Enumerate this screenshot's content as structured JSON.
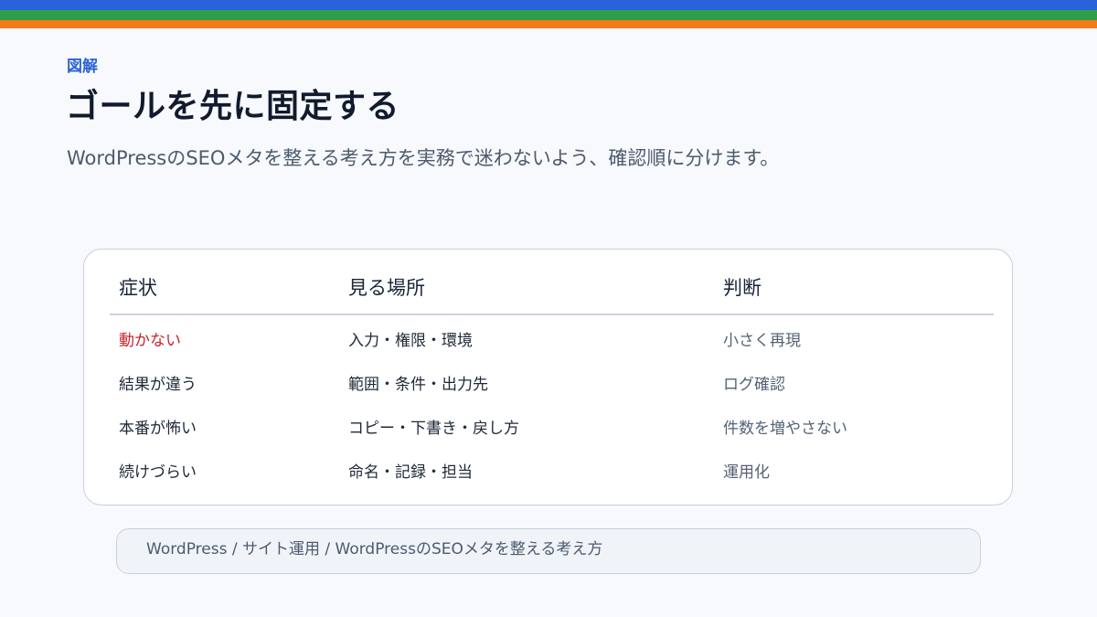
{
  "eyebrow": "図解",
  "title": "ゴールを先に固定する",
  "subtitle": "WordPressのSEOメタを整える考え方を実務で迷わないよう、確認順に分けます。",
  "table": {
    "headers": [
      "症状",
      "見る場所",
      "判断"
    ],
    "rows": [
      [
        "動かない",
        "入力・権限・環境",
        "小さく再現"
      ],
      [
        "結果が違う",
        "範囲・条件・出力先",
        "ログ確認"
      ],
      [
        "本番が怖い",
        "コピー・下書き・戻し方",
        "件数を増やさない"
      ],
      [
        "続けづらい",
        "命名・記録・担当",
        "運用化"
      ]
    ]
  },
  "breadcrumb": "WordPress / サイト運用 / WordPressのSEOメタを整える考え方",
  "colors": {
    "stripe_blue": "#2962d9",
    "stripe_green": "#2e9e48",
    "stripe_orange": "#f27a1a",
    "accent": "#2b63d6",
    "alert": "#c8242b"
  }
}
